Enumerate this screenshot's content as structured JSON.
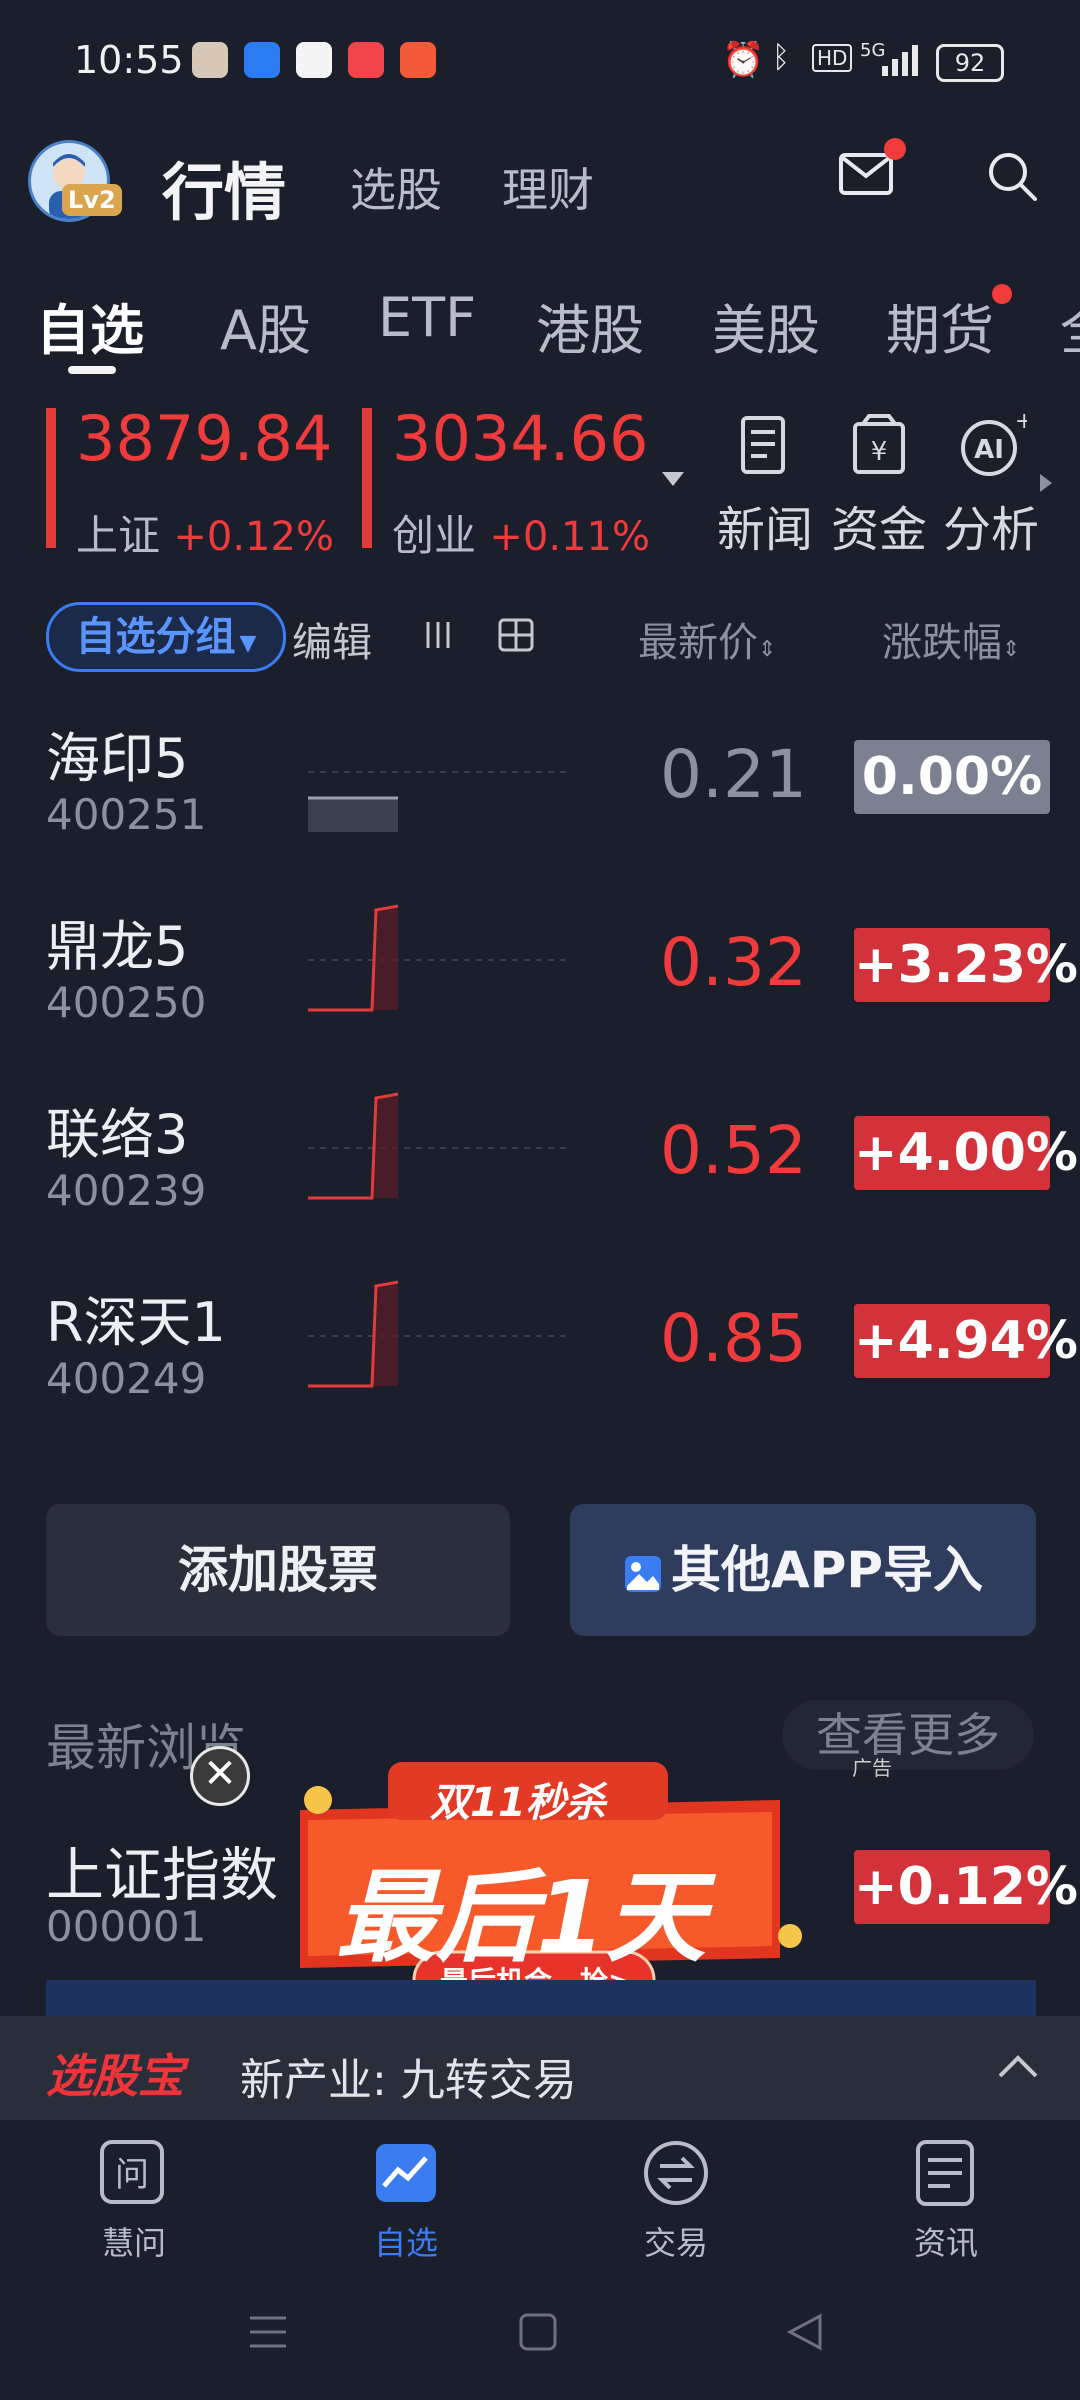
{
  "status_bar": {
    "time": "10:55",
    "battery": "92",
    "network": "5G",
    "hd": "HD"
  },
  "header": {
    "avatar_level": "Lv2",
    "title": "行情",
    "links": [
      "选股",
      "理财"
    ]
  },
  "market_tabs": [
    "自选",
    "A股",
    "ETF",
    "港股",
    "美股",
    "期货",
    "全"
  ],
  "indices": [
    {
      "value": "3879.84",
      "name": "上证",
      "change": "+0.12%"
    },
    {
      "value": "3034.66",
      "name": "创业",
      "change": "+0.11%"
    }
  ],
  "tools": [
    {
      "icon": "news-icon",
      "label": "新闻"
    },
    {
      "icon": "fund-icon",
      "label": "资金"
    },
    {
      "icon": "ai-analysis-icon",
      "label": "分析"
    }
  ],
  "filter": {
    "group_label": "自选分组",
    "edit_label": "编辑",
    "price_header": "最新价",
    "change_header": "涨跌幅"
  },
  "watchlist": [
    {
      "name": "海印5",
      "code": "400251",
      "price": "0.21",
      "change": "0.00%",
      "trend": "flat"
    },
    {
      "name": "鼎龙5",
      "code": "400250",
      "price": "0.32",
      "change": "+3.23%",
      "trend": "up"
    },
    {
      "name": "联络3",
      "code": "400239",
      "price": "0.52",
      "change": "+4.00%",
      "trend": "up"
    },
    {
      "name": "R深天1",
      "code": "400249",
      "price": "0.85",
      "change": "+4.94%",
      "trend": "up"
    }
  ],
  "actions": {
    "add_label": "添加股票",
    "import_label": "其他APP导入"
  },
  "recent": {
    "title": "最新浏览",
    "more_label": "查看更多",
    "items": [
      {
        "name": "上证指数",
        "code": "000001",
        "change": "+0.12%"
      }
    ]
  },
  "ad": {
    "tag": "广告",
    "headline": "双11秒杀",
    "big_text": "最后1天",
    "cta": "最后机会，抢>"
  },
  "ticker": {
    "brand": "选股宝",
    "text": "新产业: 九转交易"
  },
  "bottom_nav": [
    {
      "icon": "ask-icon",
      "label": "慧问",
      "active": false
    },
    {
      "icon": "watchlist-icon",
      "label": "自选",
      "active": true
    },
    {
      "icon": "trade-icon",
      "label": "交易",
      "active": false
    },
    {
      "icon": "news-doc-icon",
      "label": "资讯",
      "active": false
    }
  ],
  "colors": {
    "up": "#ef3b3b",
    "flat": "#8c91a0",
    "accent": "#3b7cf0",
    "background": "#1b1e2b"
  }
}
